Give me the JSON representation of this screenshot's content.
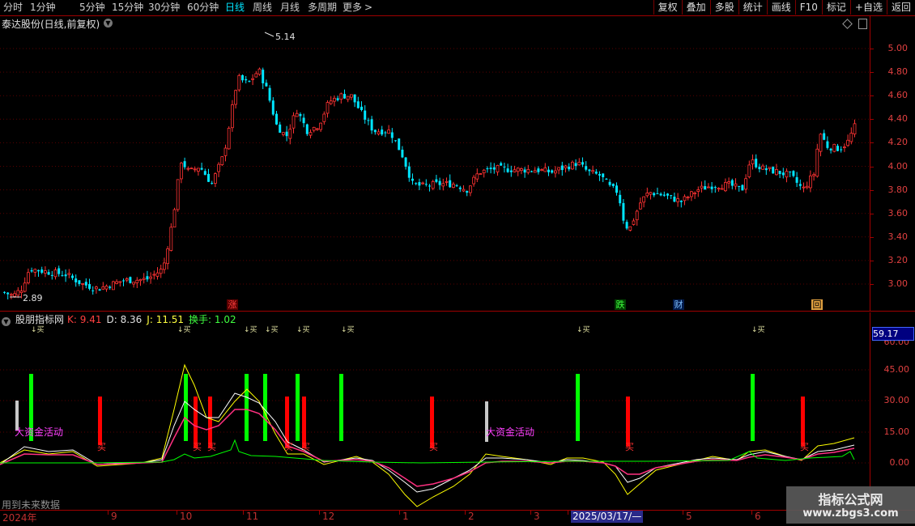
{
  "toolbar": {
    "timeframes": [
      "分时",
      "1分钟",
      "5分钟",
      "15分钟",
      "30分钟",
      "60分钟",
      "日线",
      "周线",
      "月线",
      "多周期",
      "更多"
    ],
    "more_arrow": ">",
    "active_timeframe": "日线",
    "tools": [
      "复权",
      "叠加",
      "多股",
      "统计",
      "画线",
      "F10",
      "标记",
      "+自选",
      "返回"
    ]
  },
  "main_chart": {
    "title": "泰达股份(日线,前复权)",
    "price_axis": [
      "5.00",
      "4.80",
      "4.60",
      "4.40",
      "4.20",
      "4.00",
      "3.80",
      "3.60",
      "3.40",
      "3.20",
      "3.00"
    ],
    "high_label": "5.14",
    "low_label": "2.89",
    "events": [
      {
        "text": "涨",
        "color": "#ff4040",
        "bg": "#5a0000"
      },
      {
        "text": "跌",
        "color": "#40ff40",
        "bg": "#004000"
      },
      {
        "text": "财",
        "color": "#80c0ff",
        "bg": "#001a4a"
      },
      {
        "text": "回",
        "color": "#000000",
        "bg": "#e0a040"
      }
    ],
    "colors": {
      "up": "#ff3333",
      "down": "#00e5ff",
      "axis": "#a00000",
      "grid": "#5a0000"
    }
  },
  "indicator": {
    "name": "股朋指标网",
    "k_label": "K: 9.41",
    "d_label": "D: 8.36",
    "j_label": "J: 11.51",
    "turnover_label": "换手: 1.02",
    "badge": "59.17",
    "axis": [
      "45.00",
      "30.00",
      "15.00",
      "0.00"
    ],
    "axis_partial": "60.00",
    "signals": {
      "top_marker": "↓买",
      "buy": "买",
      "big_money": "大资金活动"
    },
    "colors": {
      "k": "#ffffff",
      "d": "#ffff00",
      "j": "#ff3080",
      "turnover": "#00ff00",
      "buy_bar": "#ff0000",
      "green_bar": "#00ff00",
      "gray_bar": "#c8c8c8"
    }
  },
  "date_axis": {
    "labels": [
      "2024年",
      "9",
      "10",
      "11",
      "12",
      "1",
      "2",
      "3",
      "2025/03/17/—",
      "5",
      "6"
    ],
    "highlight": "2025/03/17/—"
  },
  "note": "用到未来数据",
  "watermark": {
    "title": "指标公式网",
    "url": "www.zbgs3.com"
  }
}
